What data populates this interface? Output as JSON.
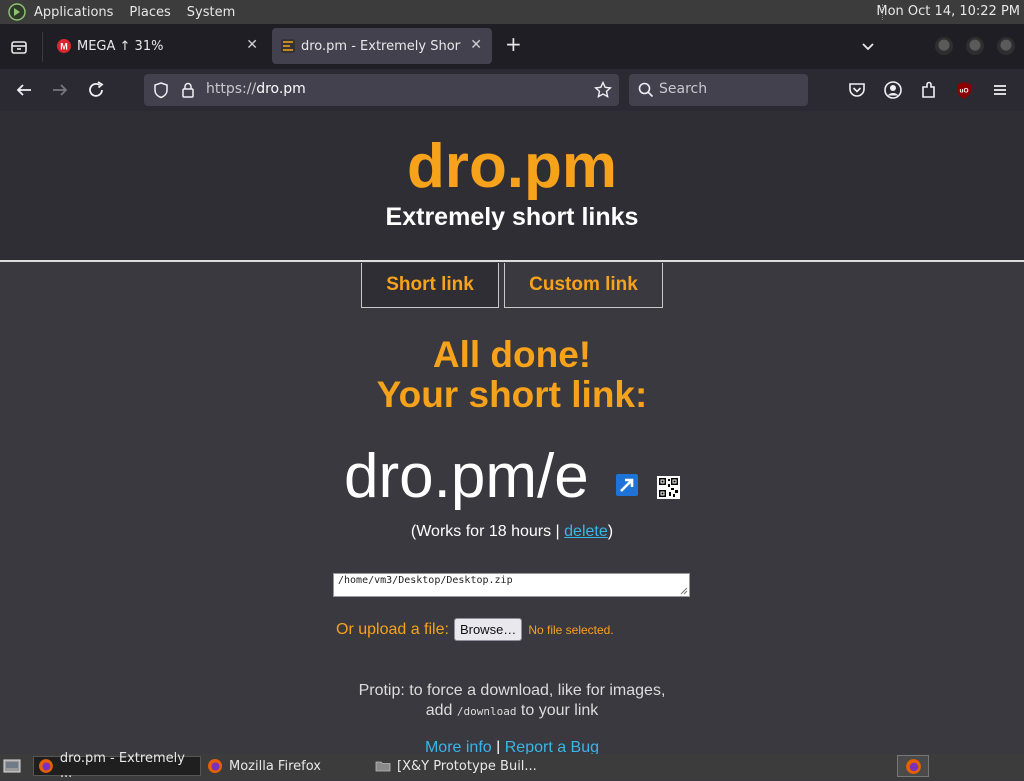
{
  "system_panel": {
    "menus": [
      "Applications",
      "Places",
      "System"
    ],
    "clock": "Mon Oct 14, 10:22 PM"
  },
  "tabs": [
    {
      "title": "MEGA ↑ 31%",
      "active": false
    },
    {
      "title": "dro.pm - Extremely Short Links",
      "active": true
    }
  ],
  "urlbar": {
    "scheme": "https://",
    "host": "dro.pm"
  },
  "searchbar": {
    "placeholder": "Search"
  },
  "page": {
    "brand": "dro.pm",
    "tagline": "Extremely short links",
    "mode_tabs": [
      "Short link",
      "Custom link"
    ],
    "done_line1": "All done!",
    "done_line2": "Your short link:",
    "short_link": "dro.pm/e",
    "works_prefix": "(Works for 18 hours | ",
    "delete_label": "delete",
    "works_suffix": ")",
    "path_value": "/home/vm3/Desktop/Desktop.zip",
    "upload_label": "Or upload a file:",
    "browse_label": "Browse…",
    "no_file_label": "No file selected.",
    "protip_line1": "Protip: to force a download, like for images,",
    "protip_add": "add",
    "protip_code": "/download",
    "protip_tail": "to your link",
    "more_info": "More info",
    "footer_sep": "|",
    "report_bug": "Report a Bug"
  },
  "taskbar": {
    "items": [
      {
        "label": "dro.pm - Extremely ...",
        "active": true
      },
      {
        "label": "Mozilla Firefox",
        "active": false
      },
      {
        "label": "[X&Y Prototype Buil...",
        "active": false
      }
    ]
  },
  "colors": {
    "accent": "#f7a21b",
    "link": "#38b6e8",
    "page_bg": "#3a393f"
  }
}
